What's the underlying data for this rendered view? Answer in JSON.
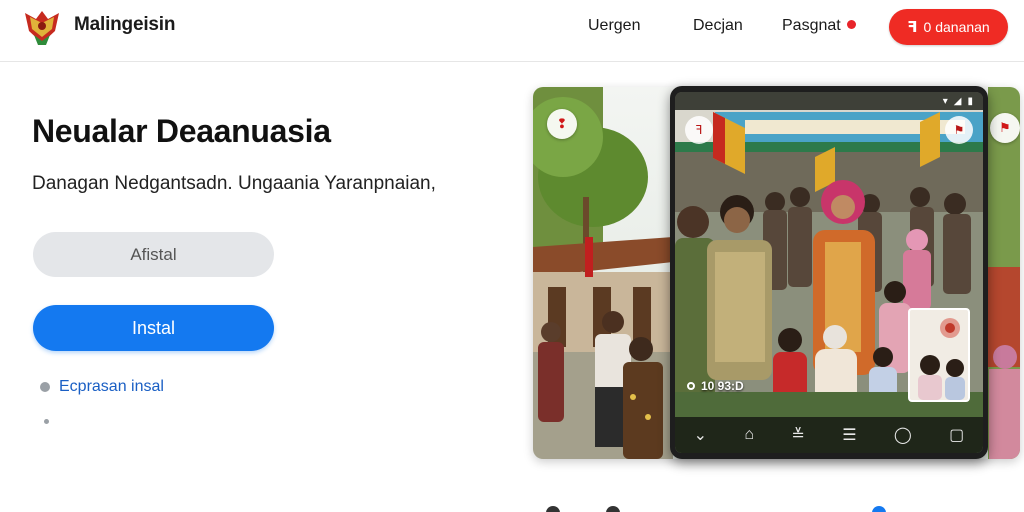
{
  "header": {
    "brand": "Malingeisin",
    "logo_icon": "garuda-emblem-icon",
    "nav": [
      {
        "label": "Uergen"
      },
      {
        "label": "Decjan"
      },
      {
        "label": "Pasgnat"
      }
    ],
    "cta_label": "0 dananan",
    "cta_icon": "flag-icon"
  },
  "hero": {
    "title": "Neualar Deaanuasia",
    "subtitle": "Danagan Nedgantsadn. Ungaania Yaranpnaian,",
    "secondary_button": "Afistal",
    "primary_button": "Instal",
    "alt_link": "Ecprasan insal"
  },
  "showcase": {
    "phone_rec_text": "10 93:D",
    "phone_nav_icons": [
      "back-icon",
      "home-icon",
      "tune-icon",
      "menu-icon",
      "circle-icon",
      "square-icon"
    ]
  },
  "colors": {
    "cta": "#ef2b24",
    "primary": "#1479f0",
    "secondary": "#e4e6e9",
    "link": "#1a5fc4"
  }
}
